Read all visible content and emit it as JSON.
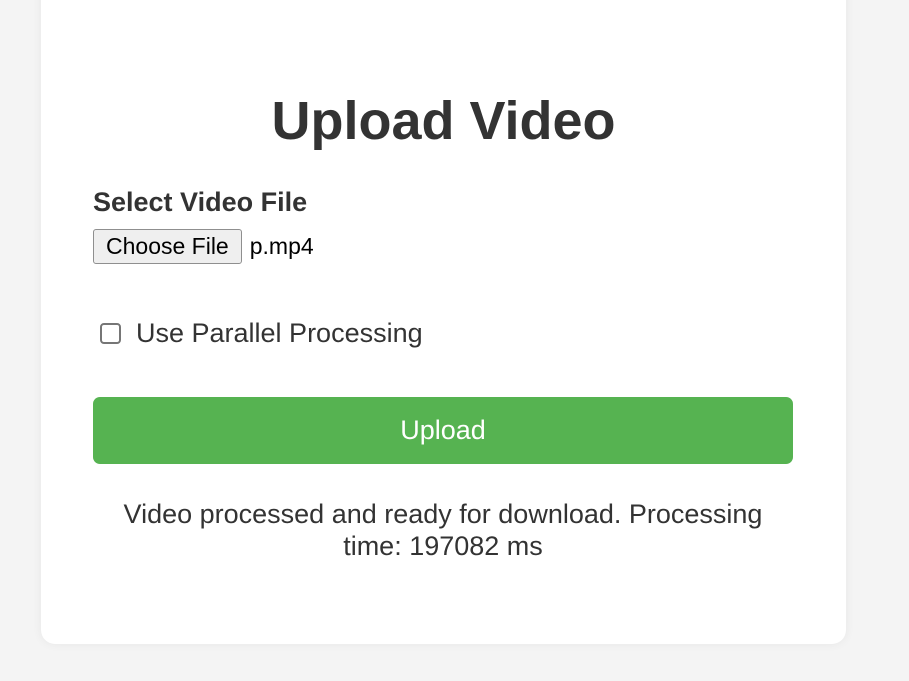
{
  "page": {
    "title": "Upload Video",
    "background_color": "#f4f4f4"
  },
  "form": {
    "file_label": "Select Video File",
    "choose_file_label": "Choose File",
    "file_name": "p.mp4",
    "parallel_label": "Use Parallel Processing",
    "parallel_checked": false,
    "upload_label": "Upload",
    "upload_color": "#56b351"
  },
  "status": {
    "message": "Video processed and ready for download. Processing time: 197082 ms"
  }
}
